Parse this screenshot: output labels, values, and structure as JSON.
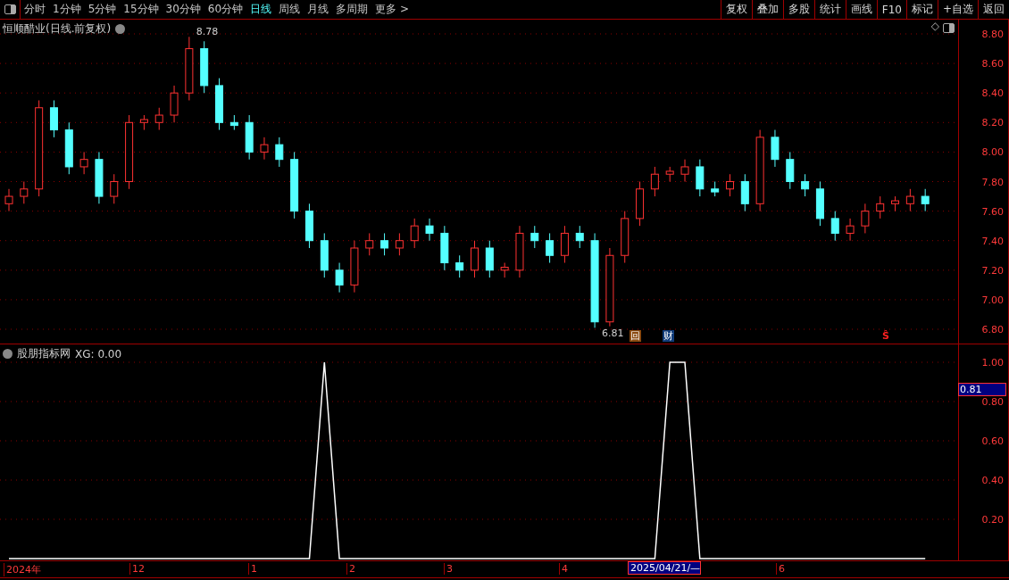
{
  "toolbar": {
    "tabs": [
      {
        "label": "分时",
        "selected": false
      },
      {
        "label": "1分钟",
        "selected": false
      },
      {
        "label": "5分钟",
        "selected": false
      },
      {
        "label": "15分钟",
        "selected": false
      },
      {
        "label": "30分钟",
        "selected": false
      },
      {
        "label": "60分钟",
        "selected": false
      },
      {
        "label": "日线",
        "selected": true
      },
      {
        "label": "周线",
        "selected": false
      },
      {
        "label": "月线",
        "selected": false
      },
      {
        "label": "多周期",
        "selected": false
      },
      {
        "label": "更多 >",
        "selected": false
      }
    ],
    "buttons": [
      "复权",
      "叠加",
      "多股",
      "统计",
      "画线",
      "F10",
      "标记",
      "+自选",
      "返回"
    ]
  },
  "price_panel": {
    "title": "恒顺醋业(日线.前复权)",
    "corner_glyph": "◇",
    "high_label": "8.78",
    "low_label": "6.81",
    "markers": [
      {
        "kind": "box",
        "text": "回"
      },
      {
        "kind": "finance",
        "text": "财"
      },
      {
        "kind": "sign",
        "text": "Ŝ"
      }
    ],
    "chart_data": {
      "type": "candlestick",
      "grid": true,
      "ylim": [
        6.8,
        8.8
      ],
      "yticks": [
        {
          "value": 6.8,
          "label": "6.80"
        },
        {
          "value": 7.0,
          "label": "7.00"
        },
        {
          "value": 7.2,
          "label": "7.20"
        },
        {
          "value": 7.4,
          "label": "7.40"
        },
        {
          "value": 7.6,
          "label": "7.60"
        },
        {
          "value": 7.8,
          "label": "7.80"
        },
        {
          "value": 8.0,
          "label": "8.00"
        },
        {
          "value": 8.2,
          "label": "8.20"
        },
        {
          "value": 8.4,
          "label": "8.40"
        },
        {
          "value": 8.6,
          "label": "8.60"
        },
        {
          "value": 8.8,
          "label": "8.80"
        }
      ],
      "ohlc": [
        [
          7.65,
          7.75,
          7.6,
          7.7
        ],
        [
          7.7,
          7.8,
          7.65,
          7.75
        ],
        [
          7.75,
          8.35,
          7.7,
          8.3
        ],
        [
          8.3,
          8.35,
          8.1,
          8.15
        ],
        [
          8.15,
          8.2,
          7.85,
          7.9
        ],
        [
          7.9,
          8.0,
          7.85,
          7.95
        ],
        [
          7.95,
          8.0,
          7.65,
          7.7
        ],
        [
          7.7,
          7.85,
          7.65,
          7.8
        ],
        [
          7.8,
          8.25,
          7.75,
          8.2
        ],
        [
          8.2,
          8.25,
          8.15,
          8.22
        ],
        [
          8.2,
          8.3,
          8.15,
          8.25
        ],
        [
          8.25,
          8.45,
          8.2,
          8.4
        ],
        [
          8.4,
          8.78,
          8.35,
          8.7
        ],
        [
          8.7,
          8.75,
          8.4,
          8.45
        ],
        [
          8.45,
          8.5,
          8.15,
          8.2
        ],
        [
          8.2,
          8.25,
          8.15,
          8.18
        ],
        [
          8.2,
          8.25,
          7.95,
          8.0
        ],
        [
          8.0,
          8.1,
          7.95,
          8.05
        ],
        [
          8.05,
          8.1,
          7.9,
          7.95
        ],
        [
          7.95,
          8.0,
          7.55,
          7.6
        ],
        [
          7.6,
          7.65,
          7.35,
          7.4
        ],
        [
          7.4,
          7.45,
          7.15,
          7.2
        ],
        [
          7.2,
          7.25,
          7.05,
          7.1
        ],
        [
          7.1,
          7.4,
          7.05,
          7.35
        ],
        [
          7.35,
          7.45,
          7.3,
          7.4
        ],
        [
          7.4,
          7.45,
          7.3,
          7.35
        ],
        [
          7.35,
          7.45,
          7.3,
          7.4
        ],
        [
          7.4,
          7.55,
          7.35,
          7.5
        ],
        [
          7.5,
          7.55,
          7.4,
          7.45
        ],
        [
          7.45,
          7.5,
          7.2,
          7.25
        ],
        [
          7.25,
          7.3,
          7.15,
          7.2
        ],
        [
          7.2,
          7.4,
          7.15,
          7.35
        ],
        [
          7.35,
          7.4,
          7.15,
          7.2
        ],
        [
          7.2,
          7.25,
          7.15,
          7.22
        ],
        [
          7.2,
          7.5,
          7.15,
          7.45
        ],
        [
          7.45,
          7.5,
          7.35,
          7.4
        ],
        [
          7.4,
          7.45,
          7.25,
          7.3
        ],
        [
          7.3,
          7.5,
          7.25,
          7.45
        ],
        [
          7.45,
          7.5,
          7.35,
          7.4
        ],
        [
          7.4,
          7.45,
          6.81,
          6.85
        ],
        [
          6.85,
          7.35,
          6.82,
          7.3
        ],
        [
          7.3,
          7.6,
          7.25,
          7.55
        ],
        [
          7.55,
          7.8,
          7.5,
          7.75
        ],
        [
          7.75,
          7.9,
          7.7,
          7.85
        ],
        [
          7.85,
          7.9,
          7.8,
          7.87
        ],
        [
          7.85,
          7.95,
          7.8,
          7.9
        ],
        [
          7.9,
          7.95,
          7.7,
          7.75
        ],
        [
          7.75,
          7.8,
          7.7,
          7.73
        ],
        [
          7.75,
          7.85,
          7.7,
          7.8
        ],
        [
          7.8,
          7.85,
          7.6,
          7.65
        ],
        [
          7.65,
          8.15,
          7.6,
          8.1
        ],
        [
          8.1,
          8.15,
          7.9,
          7.95
        ],
        [
          7.95,
          8.0,
          7.75,
          7.8
        ],
        [
          7.8,
          7.85,
          7.7,
          7.75
        ],
        [
          7.75,
          7.8,
          7.5,
          7.55
        ],
        [
          7.55,
          7.6,
          7.4,
          7.45
        ],
        [
          7.45,
          7.55,
          7.4,
          7.5
        ],
        [
          7.5,
          7.65,
          7.45,
          7.6
        ],
        [
          7.6,
          7.7,
          7.55,
          7.65
        ],
        [
          7.65,
          7.7,
          7.6,
          7.67
        ],
        [
          7.65,
          7.75,
          7.6,
          7.7
        ],
        [
          7.7,
          7.75,
          7.6,
          7.65
        ]
      ]
    }
  },
  "indicator_panel": {
    "title": "股朋指标网",
    "reading": "XG: 0.00",
    "cursor_value": "0.81",
    "chart_data": {
      "type": "line",
      "grid": true,
      "ylim": [
        0,
        1
      ],
      "yticks": [
        {
          "value": 0.2,
          "label": "0.20"
        },
        {
          "value": 0.4,
          "label": "0.40"
        },
        {
          "value": 0.6,
          "label": "0.60"
        },
        {
          "value": 0.8,
          "label": "0.80"
        },
        {
          "value": 1.0,
          "label": "1.00"
        }
      ],
      "values": [
        0,
        0,
        0,
        0,
        0,
        0,
        0,
        0,
        0,
        0,
        0,
        0,
        0,
        0,
        0,
        0,
        0,
        0,
        0,
        0,
        0,
        1,
        0,
        0,
        0,
        0,
        0,
        0,
        0,
        0,
        0,
        0,
        0,
        0,
        0,
        0,
        0,
        0,
        0,
        0,
        0,
        0,
        0,
        0,
        1,
        1,
        0,
        0,
        0,
        0,
        0,
        0,
        0,
        0,
        0,
        0,
        0,
        0,
        0,
        0,
        0,
        0
      ]
    }
  },
  "x_axis": {
    "labels": [
      {
        "text": "2024年",
        "selected": false
      },
      {
        "text": "12",
        "selected": false
      },
      {
        "text": "1",
        "selected": false
      },
      {
        "text": "2",
        "selected": false
      },
      {
        "text": "3",
        "selected": false
      },
      {
        "text": "4",
        "selected": false
      },
      {
        "text": "2025/04/21/—",
        "selected": true
      },
      {
        "text": "6",
        "selected": false
      }
    ]
  }
}
